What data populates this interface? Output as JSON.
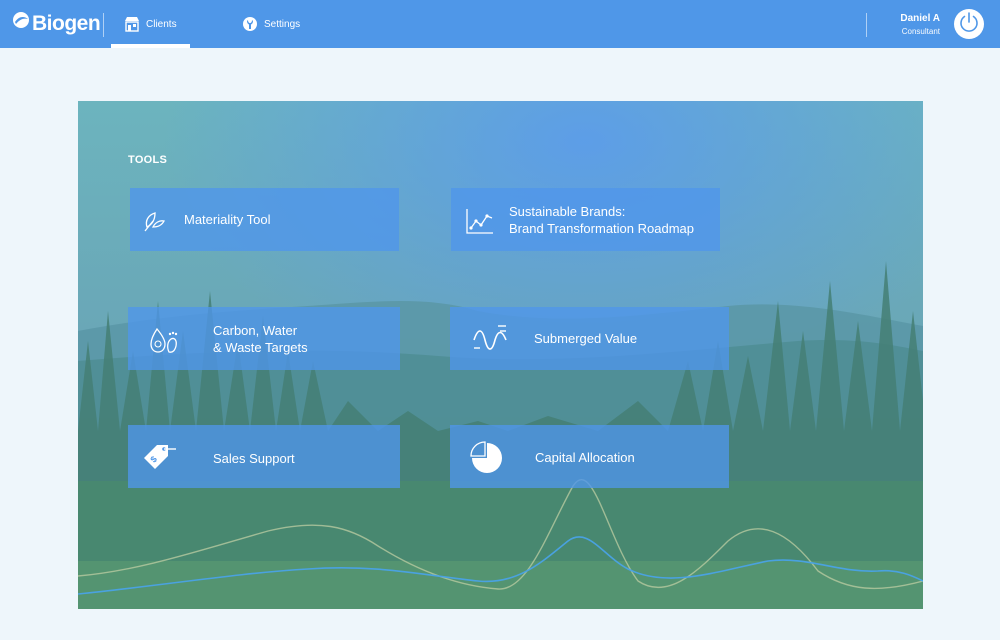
{
  "brand": {
    "name": "Biogen",
    "accent": "#4f97e8"
  },
  "nav": {
    "tabs": [
      {
        "label": "Clients",
        "icon": "storefront-icon",
        "active": true
      },
      {
        "label": "Settings",
        "icon": "wrench-icon",
        "active": false
      }
    ]
  },
  "user": {
    "name": "Daniel A",
    "role": "Consultant"
  },
  "main": {
    "section_title": "TOOLS",
    "tools": [
      {
        "label": "Materiality Tool",
        "icon": "leaf-icon"
      },
      {
        "label": "Sustainable Brands:\nBrand Transformation Roadmap",
        "icon": "line-chart-icon"
      },
      {
        "label": "Carbon, Water\n& Waste Targets",
        "icon": "footprint-icon"
      },
      {
        "label": "Submerged Value",
        "icon": "wave-icon"
      },
      {
        "label": "Sales Support",
        "icon": "price-tag-icon"
      },
      {
        "label": "Capital Allocation",
        "icon": "pie-chart-icon"
      }
    ]
  }
}
